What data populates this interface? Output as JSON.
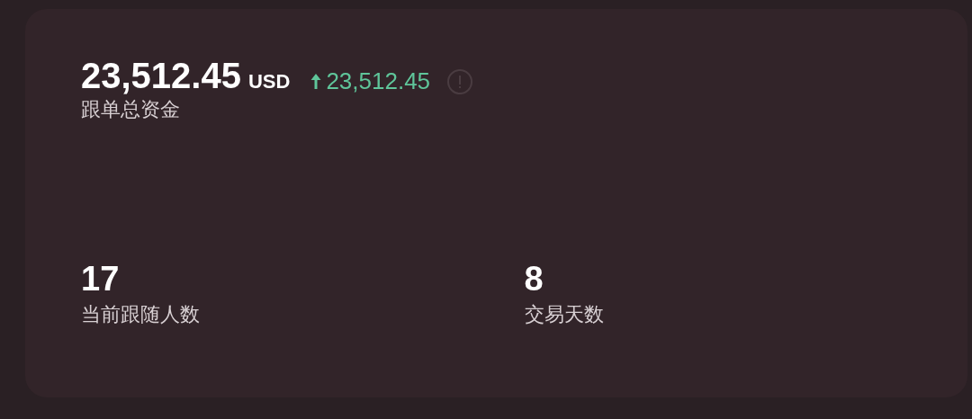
{
  "total": {
    "value": "23,512.45",
    "currency": "USD",
    "change": {
      "rising": true,
      "value": "23,512.45"
    },
    "label": "跟单总资金"
  },
  "stats": [
    {
      "value": "17",
      "label": "当前跟随人数"
    },
    {
      "value": "8",
      "label": "交易天数"
    }
  ]
}
